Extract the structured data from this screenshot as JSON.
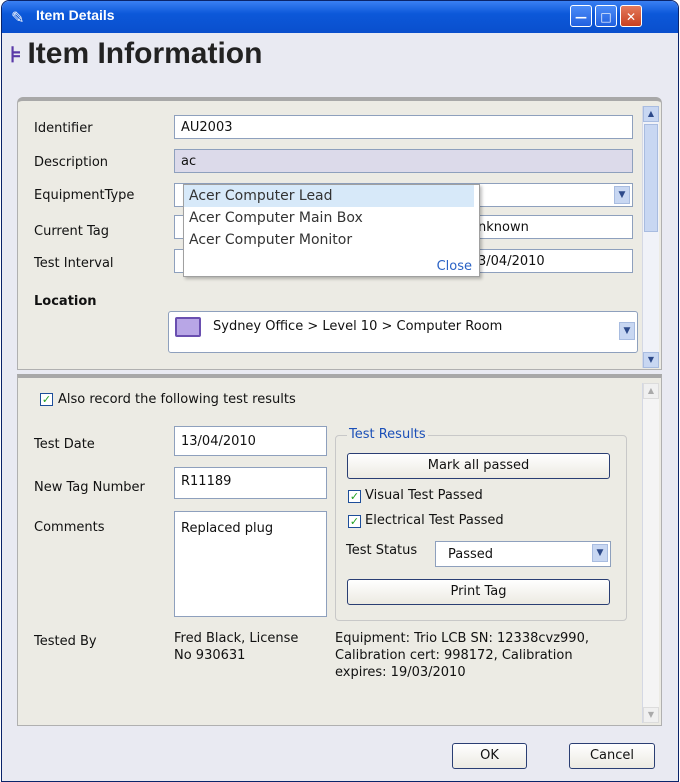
{
  "window": {
    "title": "Item Details"
  },
  "heading": "Item Information",
  "item": {
    "identifier_label": "Identifier",
    "identifier_value": "AU2003",
    "description_label": "Description",
    "description_value": "ac",
    "equipment_type_label": "EquipmentType",
    "current_tag_label": "Current Tag",
    "current_tag_value": "nknown",
    "test_interval_label": "Test Interval",
    "test_interval_value": "3/04/2010",
    "location_label": "Location",
    "location_value": "Sydney Office > Level 10 > Computer Room"
  },
  "autocomplete": {
    "options": [
      "Acer Computer Lead",
      "Acer Computer Main Box",
      "Acer Computer Monitor"
    ],
    "close_label": "Close"
  },
  "test": {
    "also_record_label": "Also record the following test results",
    "also_record_checked": true,
    "test_date_label": "Test Date",
    "test_date_value": "13/04/2010",
    "new_tag_label": "New Tag Number",
    "new_tag_value": "R11189",
    "comments_label": "Comments",
    "comments_value": "Replaced plug",
    "tested_by_label": "Tested By",
    "tested_by_line1": "Fred Black, License",
    "tested_by_line2": "No 930631",
    "equipment_line1": "Equipment: Trio LCB SN: 12338cvz990,",
    "equipment_line2": "Calibration cert: 998172, Calibration",
    "equipment_line3": "expires: 19/03/2010"
  },
  "results": {
    "group_title": "Test Results",
    "mark_all_label": "Mark all passed",
    "visual_label": "Visual Test Passed",
    "visual_checked": true,
    "electrical_label": "Electrical Test Passed",
    "electrical_checked": true,
    "status_label": "Test Status",
    "status_value": "Passed",
    "print_label": "Print Tag"
  },
  "buttons": {
    "ok": "OK",
    "cancel": "Cancel"
  },
  "icons": {
    "title": "item-icon",
    "heading": "item-icon",
    "location": "computer-icon",
    "minimize": "minimize-icon",
    "maximize": "maximize-icon",
    "close": "close-icon"
  },
  "colors": {
    "title_bar": "#0a4fcd",
    "accent_blue": "#1c50b8",
    "check_green": "#21a121"
  }
}
